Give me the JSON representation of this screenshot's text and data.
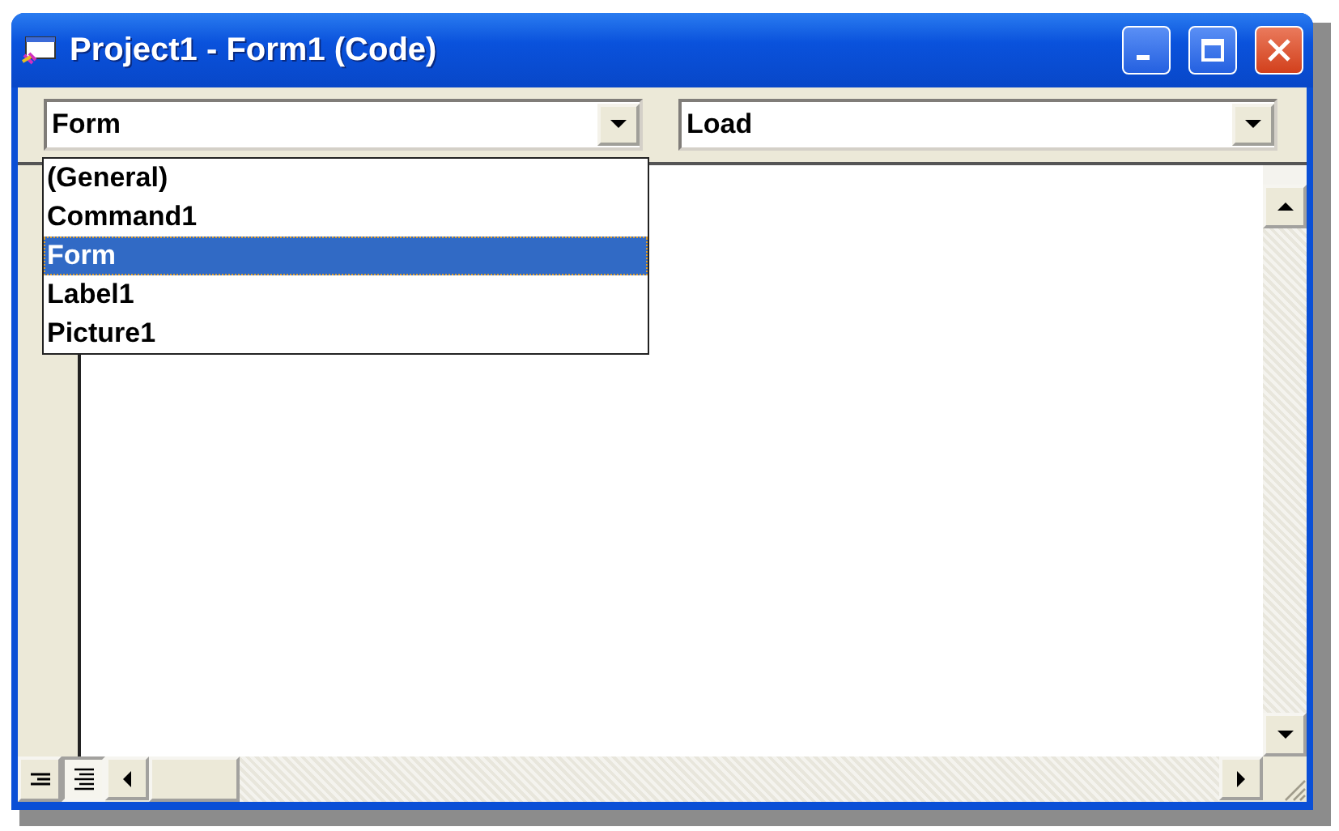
{
  "window": {
    "title": "Project1 - Form1 (Code)"
  },
  "object_combo": {
    "value": "Form",
    "expanded": true,
    "options": [
      {
        "label": "(General)",
        "selected": false
      },
      {
        "label": "Command1",
        "selected": false
      },
      {
        "label": "Form",
        "selected": true
      },
      {
        "label": "Label1",
        "selected": false
      },
      {
        "label": "Picture1",
        "selected": false
      }
    ]
  },
  "procedure_combo": {
    "value": "Load"
  },
  "view_buttons": [
    {
      "kind": "procedure",
      "selected": false
    },
    {
      "kind": "module",
      "selected": true
    }
  ]
}
